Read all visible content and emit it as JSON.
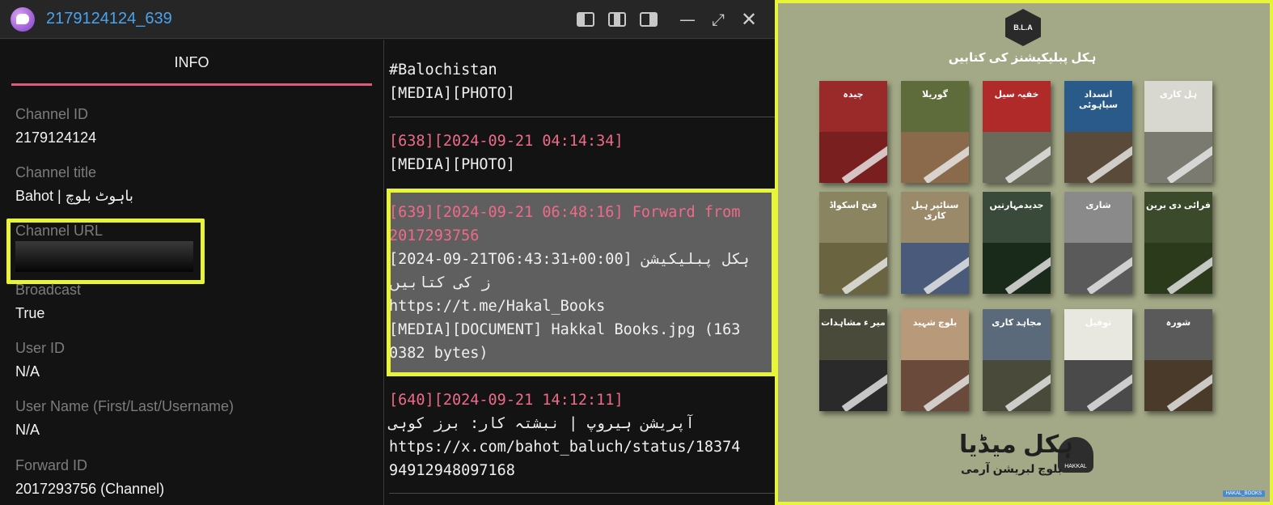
{
  "window": {
    "title": "2179124124_639",
    "controls": [
      "layout-left-icon",
      "layout-center-icon",
      "layout-right-icon",
      "minimize-icon",
      "maximize-icon",
      "close-icon"
    ]
  },
  "info": {
    "tab_label": "INFO",
    "fields": [
      {
        "label": "Channel ID",
        "value": "2179124124"
      },
      {
        "label": "Channel title",
        "value": "Bahot | باہوٹ بلوچ"
      },
      {
        "label": "Channel URL",
        "value": ""
      },
      {
        "label": "Broadcast",
        "value": "True"
      },
      {
        "label": "User ID",
        "value": "N/A"
      },
      {
        "label": "User Name (First/Last/Username)",
        "value": "N/A"
      },
      {
        "label": "Forward ID",
        "value": "2017293756 (Channel)"
      }
    ]
  },
  "messages": {
    "m637": {
      "line1": "#Balochistan",
      "line2": "[MEDIA][PHOTO]"
    },
    "m638": {
      "header": "[638][2024-09-21 04:14:34]",
      "line1": "[MEDIA][PHOTO]"
    },
    "m639": {
      "header1": "[639][2024-09-21 06:48:16] Forward from",
      "header2": "2017293756",
      "line1": "[2024-09-21T06:43:31+00:00] ہکل پبلیکیشن",
      "line2": "ز کی کتابیں",
      "line3": "https://t.me/Hakal_Books",
      "line4": "[MEDIA][DOCUMENT] Hakkal Books.jpg (163",
      "line5": "0382 bytes)"
    },
    "m640": {
      "header": "[640][2024-09-21 14:12:11]",
      "line1": "آپریشن ہیروپ | نبشتہ کار: برز کوہی",
      "line2": "https://x.com/bahot_baluch/status/18374",
      "line3": "94912948097168"
    }
  },
  "poster": {
    "emblem_text": "B.L.A",
    "header": "ہکل پبلیکیشنز کی کتابیں",
    "books": [
      {
        "title": "چیدہ",
        "top": "#9a2a2a",
        "bot": "#7a1f1f"
      },
      {
        "title": "گوریلا",
        "top": "#5e6b3a",
        "bot": "#8a6a4a"
      },
      {
        "title": "خفیہ سیل",
        "top": "#b02a2a",
        "bot": "#6a6a5a"
      },
      {
        "title": "انسداد سیاہوئی",
        "top": "#2a5a8a",
        "bot": "#5a4a3a"
      },
      {
        "title": "ہل کاری",
        "top": "#d8d8d0",
        "bot": "#7a7a70"
      },
      {
        "title": "فتح اسکواڈ",
        "top": "#8a8560",
        "bot": "#6a6540"
      },
      {
        "title": "سنائپر ہیل کاری",
        "top": "#9a8a6a",
        "bot": "#4a5a7a"
      },
      {
        "title": "جدیدمہارتیں",
        "top": "#3a4a3a",
        "bot": "#1a2a1a"
      },
      {
        "title": "شاری",
        "top": "#8a8a8a",
        "bot": "#5a5a5a"
      },
      {
        "title": "فرائی دی برین",
        "top": "#3a4a2a",
        "bot": "#2a3a1a"
      },
      {
        "title": "میر ء مشاہدات",
        "top": "#4a4a3a",
        "bot": "#2a2a2a"
      },
      {
        "title": "بلوچ شہید",
        "top": "#b89a7a",
        "bot": "#6a4a3a"
      },
      {
        "title": "مجاہد کاری",
        "top": "#5a6a7a",
        "bot": "#4a4a3a"
      },
      {
        "title": "توفیل",
        "top": "#e8e8e0",
        "bot": "#4a4a4a"
      },
      {
        "title": "شورہ",
        "top": "#5a5a5a",
        "bot": "#4a3a2a"
      }
    ],
    "footer_title": "ہکل میڈیا",
    "footer_sub": "بلوچ لبریشن آرمی",
    "footer_logo_text": "HAKKAL",
    "watermark": "HAKAL_BOOKS"
  }
}
